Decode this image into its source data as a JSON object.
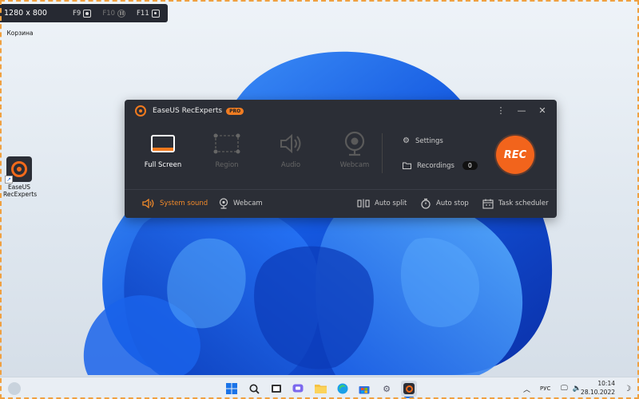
{
  "capture_hud": {
    "dimensions": "1280 x 800",
    "keys": [
      {
        "key": "F9",
        "icon": "record-icon",
        "enabled": true
      },
      {
        "key": "F10",
        "icon": "pause-icon",
        "enabled": false
      },
      {
        "key": "F11",
        "icon": "camera-icon",
        "enabled": true
      }
    ]
  },
  "desktop": {
    "recycle_bin_label": "Корзина",
    "app_icon_label": "EaseUS RecExperts"
  },
  "app": {
    "title": "EaseUS RecExperts",
    "edition_badge": "PRO",
    "accent_color": "#f2641c",
    "modes": [
      {
        "label": "Full Screen",
        "icon": "full-screen-icon",
        "active": true
      },
      {
        "label": "Region",
        "icon": "region-icon",
        "active": false
      },
      {
        "label": "Audio",
        "icon": "audio-icon",
        "active": false
      },
      {
        "label": "Webcam",
        "icon": "webcam-icon",
        "active": false
      }
    ],
    "settings_label": "Settings",
    "recordings_label": "Recordings",
    "recordings_count": "0",
    "rec_label": "REC",
    "bottom": {
      "system_sound": "System sound",
      "webcam": "Webcam",
      "auto_split": "Auto split",
      "auto_stop": "Auto stop",
      "task_scheduler": "Task scheduler"
    }
  },
  "taskbar": {
    "language": "РУС",
    "time": "10:14",
    "date": "28.10.2022"
  }
}
